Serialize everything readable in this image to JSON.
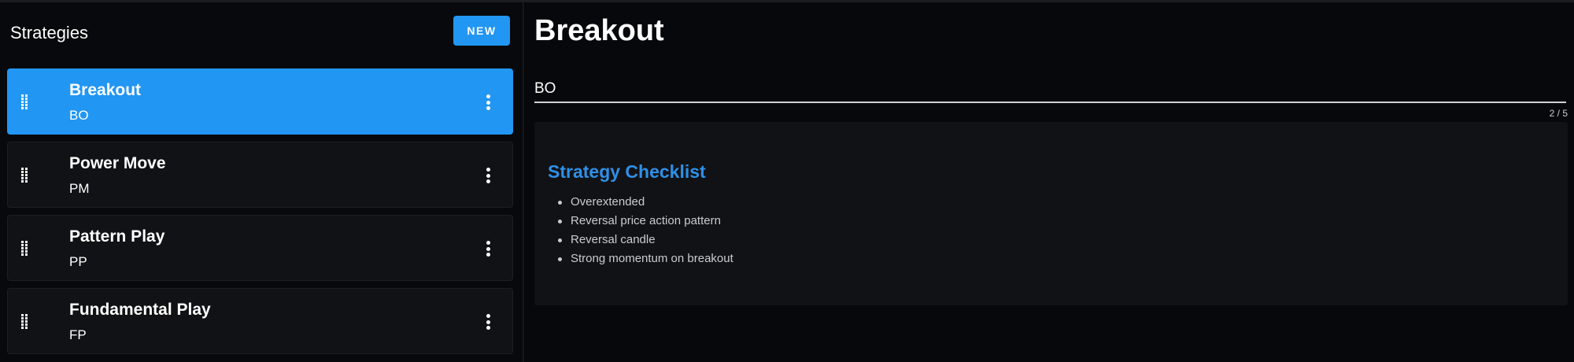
{
  "sidebar": {
    "title": "Strategies",
    "new_button_label": "NEW",
    "items": [
      {
        "name": "Breakout",
        "code": "BO",
        "selected": true
      },
      {
        "name": "Power Move",
        "code": "PM",
        "selected": false
      },
      {
        "name": "Pattern Play",
        "code": "PP",
        "selected": false
      },
      {
        "name": "Fundamental Play",
        "code": "FP",
        "selected": false
      }
    ]
  },
  "detail": {
    "title": "Breakout",
    "code_value": "BO",
    "char_counter": "2 / 5",
    "checklist": {
      "title": "Strategy Checklist",
      "items": [
        "Overextended",
        "Reversal price action pattern",
        "Reversal candle",
        "Strong momentum on breakout"
      ]
    }
  },
  "colors": {
    "accent": "#2196f3",
    "checklist_title": "#2f8fe6",
    "background": "#06070a",
    "card": "#111215"
  },
  "icons": {
    "drag": "drag-handle-icon",
    "menu": "more-vert-icon"
  }
}
